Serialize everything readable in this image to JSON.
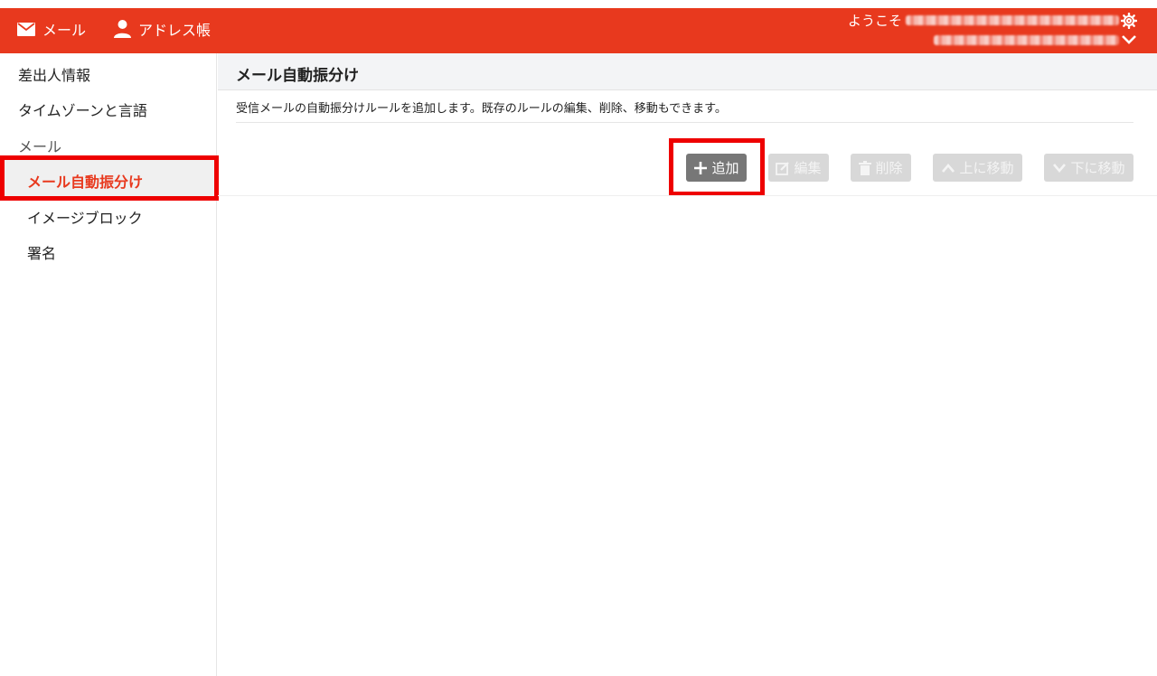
{
  "header": {
    "nav": [
      {
        "label": "メール",
        "icon": "mail-icon"
      },
      {
        "label": "アドレス帳",
        "icon": "person-icon"
      }
    ],
    "welcome_label": "ようこそ",
    "settings_icon": "gear-icon",
    "dropdown_icon": "chevron-down-icon"
  },
  "sidebar": {
    "items": [
      {
        "label": "差出人情報"
      },
      {
        "label": "タイムゾーンと言語"
      }
    ],
    "section_label": "メール",
    "sub_items": [
      {
        "label": "メール自動振分け",
        "active": true
      },
      {
        "label": "イメージブロック"
      },
      {
        "label": "署名"
      }
    ]
  },
  "main": {
    "title": "メール自動振分け",
    "description": "受信メールの自動振分けルールを追加します。既存のルールの編集、削除、移動もできます。",
    "buttons": {
      "add": "追加",
      "edit": "編集",
      "delete": "削除",
      "move_up": "上に移動",
      "move_down": "下に移動"
    }
  },
  "colors": {
    "brand": "#e8391e",
    "highlight": "#ee0000",
    "button_active": "#777777",
    "button_disabled": "#d8d8d8"
  }
}
